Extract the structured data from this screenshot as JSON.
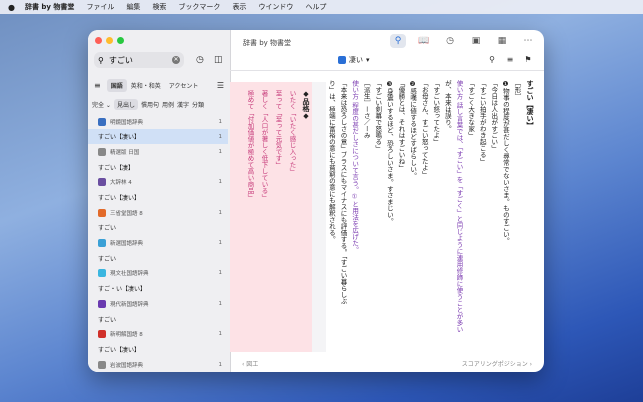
{
  "menubar": {
    "apple": "",
    "items": [
      "辞書 by 物書堂",
      "ファイル",
      "編集",
      "検索",
      "ブックマーク",
      "表示",
      "ウインドウ",
      "ヘルプ"
    ]
  },
  "window": {
    "title": "辞書 by 物書堂"
  },
  "colors": {
    "accent": "#2a6fd6",
    "selected_row": "#d0e0f6",
    "pink_pane": "#fde2e6"
  },
  "sidebar": {
    "search": {
      "value": "すごい",
      "placeholder": "検索"
    },
    "tabs": [
      "国語",
      "英和・和英",
      "アクセント"
    ],
    "filters": [
      "完全 ⌄",
      "見出し",
      "慣用句",
      "用例",
      "漢字",
      "分類"
    ],
    "rows": [
      {
        "kind": "dict",
        "label": "明鏡国語辞典",
        "count": "1",
        "color": "#3a6fc0"
      },
      {
        "kind": "word",
        "label": "すごい【凄い】",
        "count": "1",
        "selected": true
      },
      {
        "kind": "dict",
        "label": "精選版 日国",
        "count": "1",
        "color": "#888888"
      },
      {
        "kind": "word",
        "label": "すごい【凄】",
        "count": ""
      },
      {
        "kind": "dict",
        "label": "大辞林 4",
        "count": "1",
        "color": "#6a4ea0"
      },
      {
        "kind": "word",
        "label": "すごい【凄い】",
        "count": ""
      },
      {
        "kind": "dict",
        "label": "三省堂国語 8",
        "count": "1",
        "color": "#e26a2a"
      },
      {
        "kind": "word",
        "label": "すごい",
        "count": ""
      },
      {
        "kind": "dict",
        "label": "新選国語辞典",
        "count": "1",
        "color": "#3aa0d6"
      },
      {
        "kind": "word",
        "label": "すごい",
        "count": ""
      },
      {
        "kind": "dict",
        "label": "現文社国語辞典",
        "count": "1",
        "color": "#3ab6e0"
      },
      {
        "kind": "word",
        "label": "すご・い【凄い】",
        "count": ""
      },
      {
        "kind": "dict",
        "label": "現代新国語辞典",
        "count": "1",
        "color": "#6a3ab0"
      },
      {
        "kind": "word",
        "label": "すごい",
        "count": ""
      },
      {
        "kind": "dict",
        "label": "新明解国語 8",
        "count": "1",
        "color": "#d0302a"
      },
      {
        "kind": "word",
        "label": "すごい【凄い】",
        "count": ""
      },
      {
        "kind": "dict",
        "label": "岩波国語辞典",
        "count": "1",
        "color": "#888888"
      },
      {
        "kind": "word",
        "label": "すごい",
        "count": ""
      }
    ]
  },
  "main": {
    "dict_select": "凄い",
    "entry": {
      "heading": "すごい【凄い】",
      "lines": [
        "［形］",
        "❶物事の程度が甚だしく尋常でないさま。ものすごい。",
        "「今日は人出がすごい」",
        "「すごい拍手がわき起こる」",
        "「すごく大きな家」",
        "使い方 話し言葉では、「すごい」を「すごく」と同じように連用修飾に使うことが多い",
        "が、本来は誤り。",
        "「すごい怒ってたよ」",
        "「お母さん、すごい怒ってたよ」",
        "❷感嘆に値するほどすばらしい。",
        "「優勝とは、それはすごいね」",
        "❸身震いするほど、恐ろしいさま。すさまじい。",
        "「すごい剣幕で怒鳴る」",
        "［派生］ーさ／ーみ",
        "使い方 程度の甚だしさについて言う。①と用法を広げた。",
        "「本来は恐ろしさの意」ブラスにもマイナスにも評価する。「すごい暮らしぶ",
        "り」は、極端に富裕の意にも貧窮の意にも解釈される。"
      ],
      "pink_lines": [
        "◆品格◆",
        "いたく「いたく感じ入った」",
        "至って「至って元気です」",
        "著しく「人口が著しく低下している」",
        "極めて「付加価値が極めて高い商品」"
      ]
    },
    "bottom": {
      "left": "‹ 図工",
      "right": "スコアリングポジション ›"
    }
  }
}
